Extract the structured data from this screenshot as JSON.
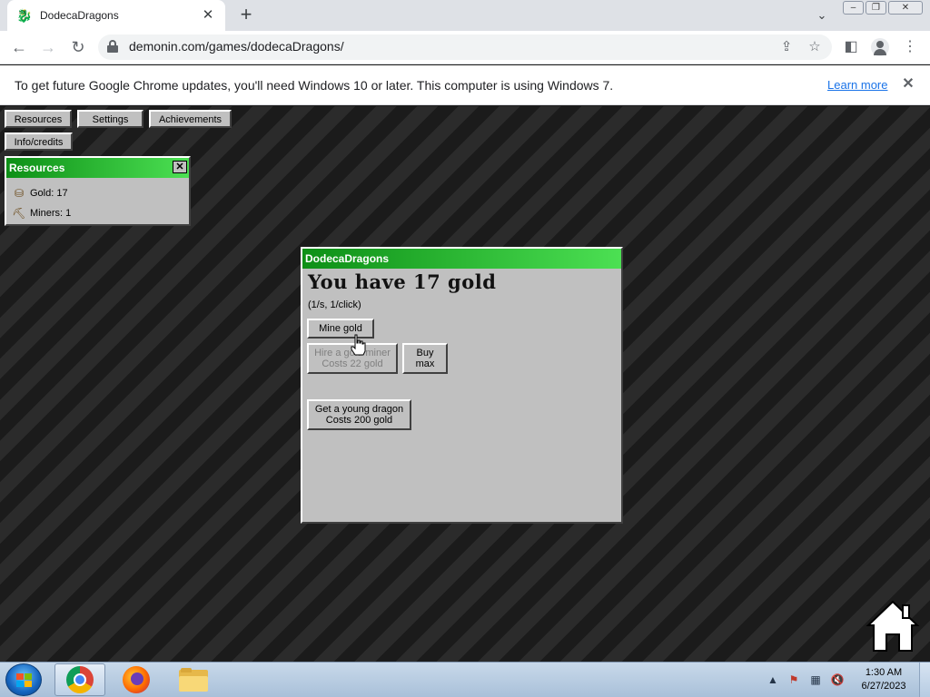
{
  "browser": {
    "tab_title": "DodecaDragons",
    "url": "demonin.com/games/dodecaDragons/",
    "infobar_message": "To get future Google Chrome updates, you'll need Windows 10 or later. This computer is using Windows 7.",
    "infobar_link": "Learn more"
  },
  "game": {
    "nav": {
      "resources": "Resources",
      "settings": "Settings",
      "achievements": "Achievements",
      "info": "Info/credits"
    },
    "resources_panel": {
      "title": "Resources",
      "gold": "Gold: 17",
      "miners": "Miners: 1"
    },
    "main_panel": {
      "title": "DodecaDragons",
      "gold_heading": "You have 17 gold",
      "rate": "(1/s, 1/click)",
      "mine_button": "Mine gold",
      "hire_miner_line1": "Hire a gold miner",
      "hire_miner_line2": "Costs 22 gold",
      "buy_max_line1": "Buy",
      "buy_max_line2": "max",
      "dragon_line1": "Get a young dragon",
      "dragon_line2": "Costs 200 gold"
    }
  },
  "taskbar": {
    "time": "1:30 AM",
    "date": "6/27/2023"
  }
}
